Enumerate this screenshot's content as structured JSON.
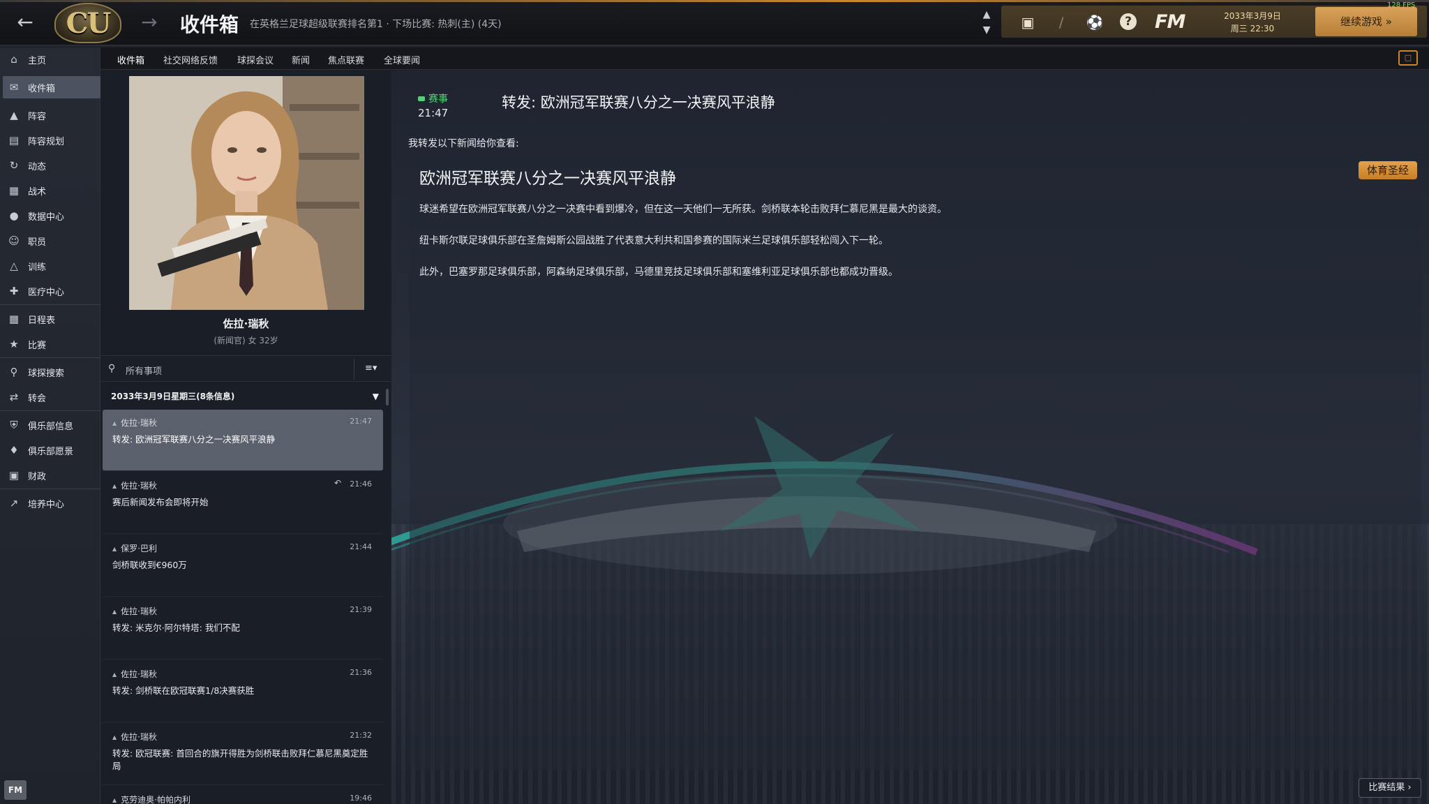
{
  "header": {
    "title": "收件箱",
    "subtitle": "在英格兰足球超级联赛排名第1 · 下场比赛: 热刺(主) (4天)",
    "club_badge_text": "CU",
    "back_icon": "arrow-left-icon",
    "forward_icon": "arrow-right-icon",
    "fm_logo": "FM",
    "date_line1": "2033年3月9日",
    "date_line2": "周三 22:30",
    "continue_label": "继续游戏",
    "fps": "128 FPS",
    "accent_color": "#c9862b"
  },
  "tabs": [
    {
      "label": "收件箱",
      "active": true
    },
    {
      "label": "社交网络反馈"
    },
    {
      "label": "球探会议"
    },
    {
      "label": "新闻"
    },
    {
      "label": "焦点联赛"
    },
    {
      "label": "全球要闻"
    }
  ],
  "sidebar": {
    "items": [
      {
        "label": "主页",
        "icon": "home-icon"
      },
      {
        "label": "收件箱",
        "icon": "inbox-icon",
        "active": true
      },
      {
        "label": "阵容",
        "icon": "shirt-icon"
      },
      {
        "label": "阵容规划",
        "icon": "clipboard-icon"
      },
      {
        "label": "动态",
        "icon": "dynamics-icon"
      },
      {
        "label": "战术",
        "icon": "tactics-board-icon"
      },
      {
        "label": "数据中心",
        "icon": "data-hub-icon"
      },
      {
        "label": "职员",
        "icon": "staff-icon"
      },
      {
        "label": "训练",
        "icon": "training-cone-icon"
      },
      {
        "label": "医疗中心",
        "icon": "medical-kit-icon"
      },
      {
        "label": "日程表",
        "icon": "calendar-icon"
      },
      {
        "label": "比赛",
        "icon": "trophy-icon"
      },
      {
        "label": "球探搜索",
        "icon": "search-icon"
      },
      {
        "label": "转会",
        "icon": "transfer-icon"
      },
      {
        "label": "俱乐部信息",
        "icon": "shield-icon"
      },
      {
        "label": "俱乐部愿景",
        "icon": "vision-icon"
      },
      {
        "label": "财政",
        "icon": "money-icon"
      },
      {
        "label": "培养中心",
        "icon": "development-icon"
      }
    ],
    "bottom_logo": "FM"
  },
  "sender": {
    "name": "佐拉·瑞秋",
    "meta": "(新闻官)  女  32岁"
  },
  "list": {
    "filter_label": "所有事项",
    "day_header": "2033年3月9日星期三(8条信息)",
    "messages": [
      {
        "from": "佐拉·瑞秋",
        "time": "21:47",
        "subject": "转发: 欧洲冠军联赛八分之一决赛风平浪静",
        "active": true
      },
      {
        "from": "佐拉·瑞秋",
        "time": "21:46",
        "subject": "赛后新闻发布会即将开始",
        "replied": true
      },
      {
        "from": "保罗·巴利",
        "time": "21:44",
        "subject": "剑桥联收到€960万"
      },
      {
        "from": "佐拉·瑞秋",
        "time": "21:39",
        "subject": "转发: 米克尔·阿尔特塔: 我们不配"
      },
      {
        "from": "佐拉·瑞秋",
        "time": "21:36",
        "subject": "转发: 剑桥联在欧冠联赛1/8决赛获胜"
      },
      {
        "from": "佐拉·瑞秋",
        "time": "21:32",
        "subject": "转发: 欧冠联赛: 首回合的旗开得胜为剑桥联击败拜仁慕尼黑奠定胜局"
      },
      {
        "from": "克劳迪奥·帕帕内利",
        "time": "19:46",
        "subject": ""
      }
    ]
  },
  "detail": {
    "category": "赛事",
    "time": "21:47",
    "title": "转发: 欧洲冠军联赛八分之一决赛风平浪静",
    "intro": "我转发以下新闻给你查看:",
    "article_title": "欧洲冠军联赛八分之一决赛风平浪静",
    "source": "体育圣经",
    "paragraphs": [
      "球迷希望在欧洲冠军联赛八分之一决赛中看到爆冷，但在这一天他们一无所获。剑桥联本轮击败拜仁慕尼黑是最大的谈资。",
      "纽卡斯尔联足球俱乐部在圣詹姆斯公园战胜了代表意大利共和国参赛的国际米兰足球俱乐部轻松闯入下一轮。",
      "此外，巴塞罗那足球俱乐部，阿森纳足球俱乐部，马德里竞技足球俱乐部和塞维利亚足球俱乐部也都成功晋级。"
    ],
    "result_button": "比赛结果"
  }
}
